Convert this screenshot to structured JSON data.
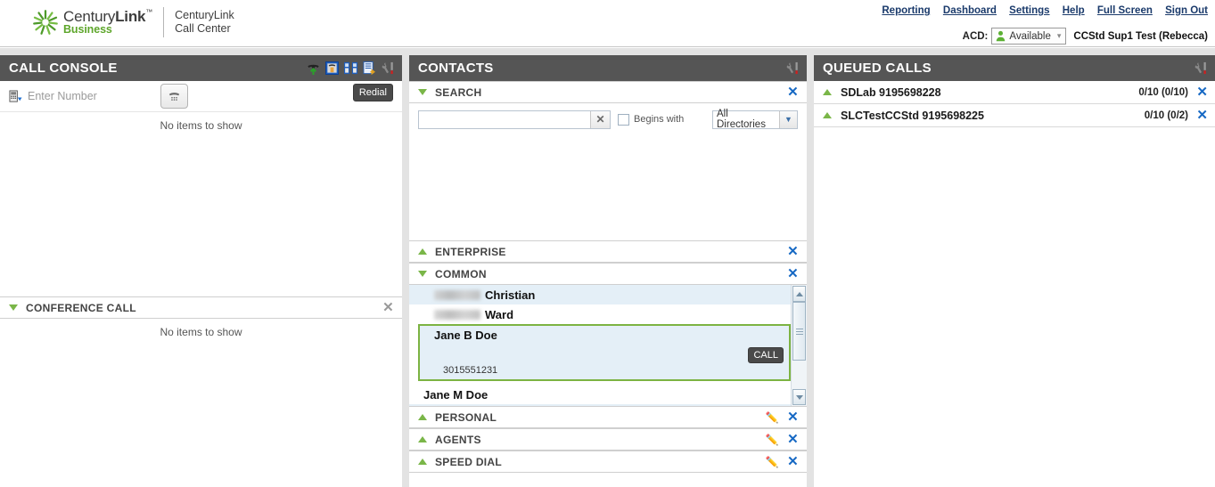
{
  "header": {
    "brand_century": "Century",
    "brand_link": "Link",
    "brand_tm": "™",
    "brand_business": "Business",
    "app_title_line1": "CenturyLink",
    "app_title_line2": "Call Center",
    "nav": [
      {
        "label": "Reporting"
      },
      {
        "label": "Dashboard"
      },
      {
        "label": "Settings"
      },
      {
        "label": "Help"
      },
      {
        "label": "Full Screen"
      },
      {
        "label": "Sign Out"
      }
    ],
    "acd_label": "ACD:",
    "acd_status": "Available",
    "acd_caret": "▾",
    "user": "CCStd Sup1 Test (Rebecca)"
  },
  "call_console": {
    "title": "CALL CONSOLE",
    "enter_number_placeholder": "Enter Number",
    "redial_label": "Redial",
    "empty_message": "No items to show",
    "tools": [
      {
        "name": "transfer-call-icon"
      },
      {
        "name": "conference-icon"
      },
      {
        "name": "group-icon"
      },
      {
        "name": "call-history-icon"
      },
      {
        "name": "options-icon"
      }
    ],
    "conference": {
      "title": "CONFERENCE CALL",
      "empty_message": "No items to show"
    }
  },
  "contacts": {
    "title": "CONTACTS",
    "search": {
      "title": "SEARCH",
      "input_value": "",
      "input_placeholder": "",
      "clear_label": "✕",
      "begins_with_label": "Begins with",
      "directory_selected": "All Directories",
      "directory_caret": "❯"
    },
    "sections": [
      {
        "title": "ENTERPRISE",
        "expanded": false,
        "has_edit": false
      },
      {
        "title": "COMMON",
        "expanded": true,
        "has_edit": false
      },
      {
        "title": "PERSONAL",
        "expanded": false,
        "has_edit": true
      },
      {
        "title": "AGENTS",
        "expanded": false,
        "has_edit": true
      },
      {
        "title": "SPEED DIAL",
        "expanded": false,
        "has_edit": true
      }
    ],
    "common_contacts": [
      {
        "first_redacted": true,
        "last": "Christian"
      },
      {
        "first_redacted": true,
        "last": "Ward"
      },
      {
        "first_redacted": false,
        "last": "Jane M Doe"
      }
    ],
    "selected_contact": {
      "name": "Jane B Doe",
      "phone": "3015551231",
      "call_label": "CALL"
    }
  },
  "queued_calls": {
    "title": "QUEUED CALLS",
    "queues": [
      {
        "name": "SDLab 9195698228",
        "counts": "0/10 (0/10)"
      },
      {
        "name": "SLCTestCCStd 9195698225",
        "counts": "0/10 (0/2)"
      }
    ]
  },
  "colors": {
    "panel_header": "#555555",
    "accent_green": "#7ab648",
    "link_blue": "#1769c4",
    "selection_border": "#7cb342",
    "row_alt": "#e4eff7"
  }
}
